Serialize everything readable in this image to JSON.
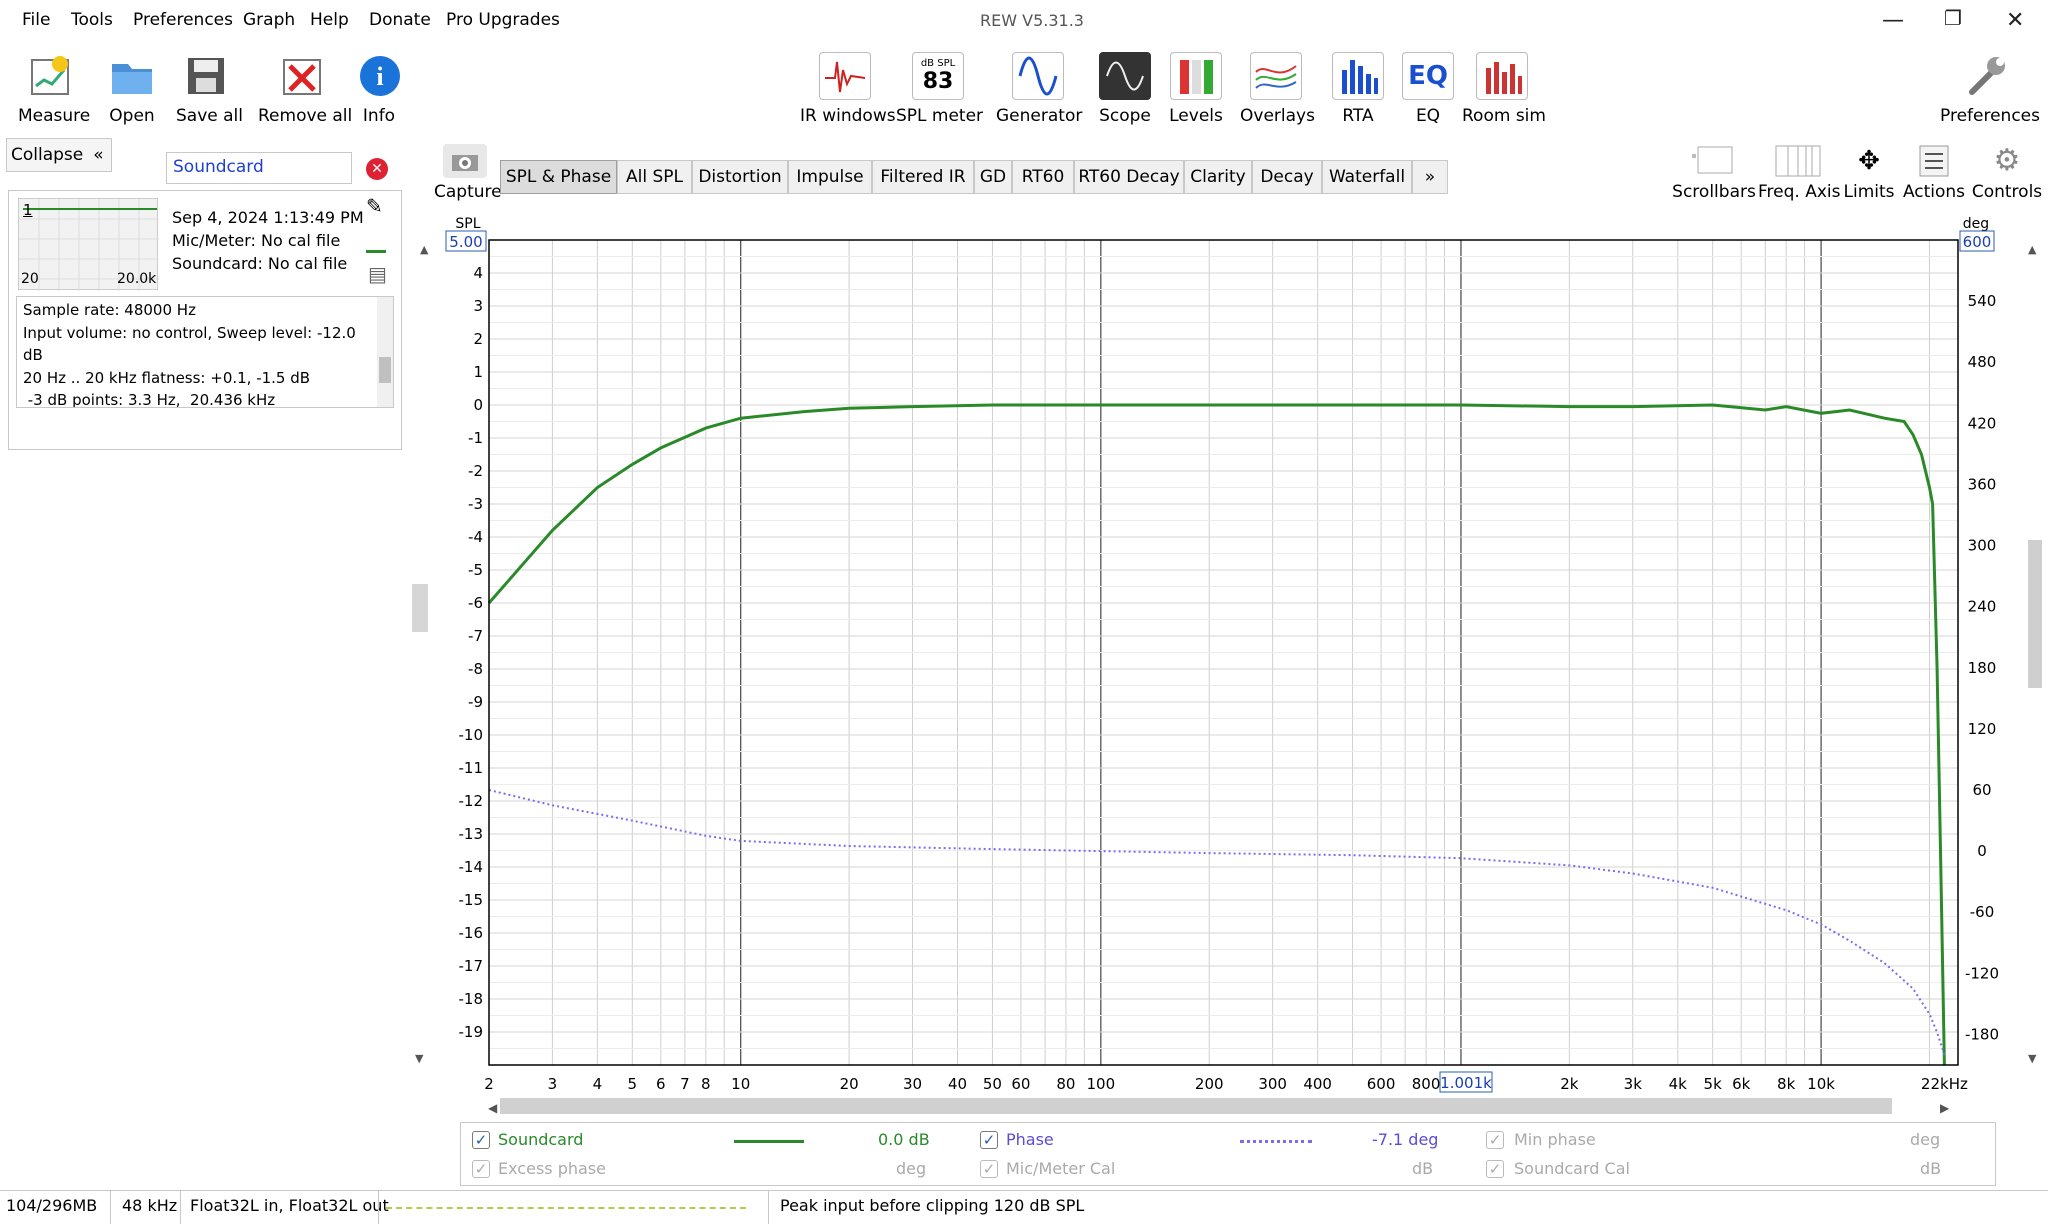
{
  "menu": [
    "File",
    "Tools",
    "Preferences",
    "Graph",
    "Help",
    "Donate",
    "Pro Upgrades"
  ],
  "window_title": "REW V5.31.3",
  "toolbar_left": [
    {
      "label": "Measure",
      "icon": "measure-icon"
    },
    {
      "label": "Open",
      "icon": "folder-icon"
    },
    {
      "label": "Save all",
      "icon": "save-icon"
    },
    {
      "label": "Remove all",
      "icon": "remove-icon"
    },
    {
      "label": "Info",
      "icon": "info-icon"
    }
  ],
  "toolbar_center": [
    {
      "label": "IR windows",
      "icon": "ir-windows-icon"
    },
    {
      "label": "SPL meter",
      "icon": "spl-meter-icon"
    },
    {
      "label": "Generator",
      "icon": "generator-icon"
    },
    {
      "label": "Scope",
      "icon": "scope-icon"
    },
    {
      "label": "Levels",
      "icon": "levels-icon"
    },
    {
      "label": "Overlays",
      "icon": "overlays-icon"
    },
    {
      "label": "RTA",
      "icon": "rta-icon"
    },
    {
      "label": "EQ",
      "icon": "eq-icon"
    },
    {
      "label": "Room sim",
      "icon": "room-sim-icon"
    }
  ],
  "spl_meter_icon": {
    "unit": "dB SPL",
    "value": "83"
  },
  "eq_icon_text": "EQ",
  "preferences_label": "Preferences",
  "collapse_label": "Collapse",
  "measurement_name": "Soundcard",
  "measurement": {
    "date": "Sep 4, 2024 1:13:49 PM",
    "mic": "Mic/Meter: No cal file",
    "soundcard": "Soundcard: No cal file",
    "thumb_number": "1",
    "thumb_left": "20",
    "thumb_right": "20.0k"
  },
  "notes": [
    "Sample rate: 48000 Hz",
    "Input volume: no control, Sweep level: -12.0",
    "dB",
    "20 Hz .. 20 kHz flatness: +0.1, -1.5 dB",
    " -3 dB points: 3.3 Hz,  20.436 kHz"
  ],
  "capture_label": "Capture",
  "tabs": [
    "SPL & Phase",
    "All SPL",
    "Distortion",
    "Impulse",
    "Filtered IR",
    "GD",
    "RT60",
    "RT60 Decay",
    "Clarity",
    "Decay",
    "Waterfall",
    "»"
  ],
  "graph_tools": [
    "Scrollbars",
    "Freq. Axis",
    "Limits",
    "Actions",
    "Controls"
  ],
  "axis": {
    "left_unit": "SPL",
    "right_unit": "deg",
    "left_top_box": "5.00",
    "right_top_box": "600",
    "cursor_box": "1.001k",
    "x_unit": "kHz"
  },
  "legend": [
    {
      "label": "Soundcard",
      "checked": true,
      "value": "0.0 dB",
      "color": "#2a8a2a"
    },
    {
      "label": "Phase",
      "checked": true,
      "value": "-7.1 deg",
      "color": "#7b6cf0"
    },
    {
      "label": "Min phase",
      "checked": true,
      "value": "deg",
      "dim": true
    },
    {
      "label": "Excess phase",
      "checked": true,
      "value": "deg",
      "dim": true
    },
    {
      "label": "Mic/Meter Cal",
      "checked": true,
      "value": "dB",
      "dim": true
    },
    {
      "label": "Soundcard Cal",
      "checked": true,
      "value": "dB",
      "dim": true
    }
  ],
  "status": {
    "memory": "104/296MB",
    "rate": "48 kHz",
    "format": "Float32L in, Float32L out",
    "peak": "Peak input before clipping 120 dB SPL"
  },
  "chart_data": {
    "type": "line",
    "xscale": "log",
    "xlim": [
      2,
      24000
    ],
    "ylim_left": [
      -20,
      5
    ],
    "ylim_right": [
      -210,
      600
    ],
    "x_ticks": [
      "2",
      "3",
      "4",
      "5",
      "6",
      "7",
      "8",
      "10",
      "20",
      "30",
      "40",
      "50",
      "60",
      "80",
      "100",
      "200",
      "300",
      "400",
      "600",
      "800",
      "1k",
      "2k",
      "3k",
      "4k",
      "5k",
      "6k",
      "8k",
      "10k",
      "22kHz"
    ],
    "y_ticks_left": [
      4,
      3,
      2,
      1,
      0,
      -1,
      -2,
      -3,
      -4,
      -5,
      -6,
      -7,
      -8,
      -9,
      -10,
      -11,
      -12,
      -13,
      -14,
      -15,
      -16,
      -17,
      -18,
      -19
    ],
    "y_ticks_right": [
      540,
      480,
      420,
      360,
      300,
      240,
      180,
      120,
      60,
      0,
      -60,
      -120,
      -180
    ],
    "series": [
      {
        "name": "Soundcard",
        "axis": "left",
        "color": "#2a8a2a",
        "style": "solid",
        "x": [
          2,
          3,
          4,
          5,
          6,
          8,
          10,
          15,
          20,
          30,
          50,
          100,
          200,
          500,
          1000,
          2000,
          3000,
          5000,
          7000,
          8000,
          10000,
          12000,
          15000,
          17000,
          18000,
          19000,
          20000,
          20400,
          21000,
          21500,
          22000
        ],
        "y": [
          -6.0,
          -3.8,
          -2.5,
          -1.8,
          -1.3,
          -0.7,
          -0.4,
          -0.2,
          -0.1,
          -0.05,
          0.0,
          0.0,
          0.0,
          0.0,
          0.0,
          -0.05,
          -0.05,
          0.0,
          -0.15,
          -0.05,
          -0.25,
          -0.15,
          -0.4,
          -0.5,
          -0.9,
          -1.5,
          -2.5,
          -3.0,
          -8.0,
          -14.0,
          -20.0
        ]
      },
      {
        "name": "Phase",
        "axis": "right",
        "color": "#7b6cf0",
        "style": "dotted",
        "x": [
          2,
          3,
          5,
          8,
          10,
          20,
          50,
          100,
          200,
          500,
          1000,
          2000,
          3000,
          5000,
          8000,
          10000,
          12000,
          15000,
          18000,
          20000,
          21000,
          22000
        ],
        "y": [
          60,
          45,
          30,
          15,
          10,
          5,
          2,
          0,
          -2,
          -4,
          -7,
          -14,
          -22,
          -36,
          -58,
          -72,
          -88,
          -110,
          -135,
          -160,
          -178,
          -200
        ]
      }
    ]
  }
}
